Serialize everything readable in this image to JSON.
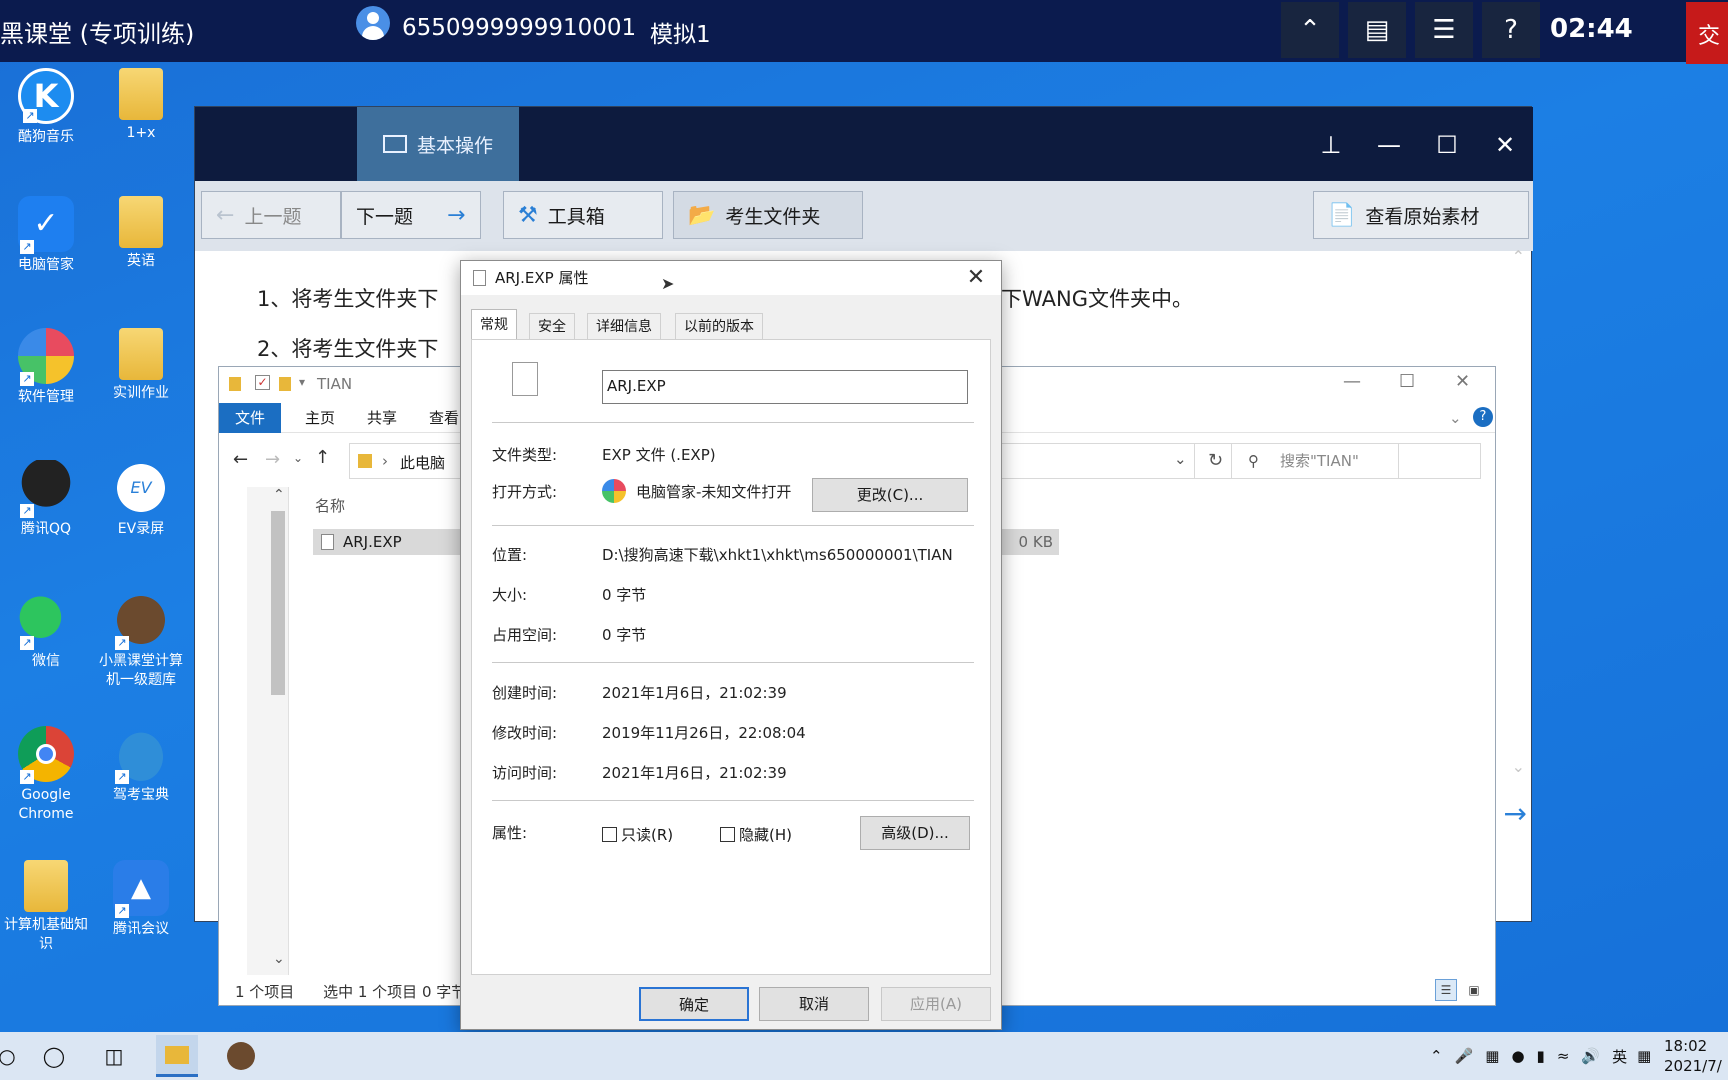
{
  "topbar": {
    "app_title": "黑课堂 (专项训练)",
    "exam_id": "6550999999910001",
    "mode": "模拟1",
    "timer": "02:44",
    "end_label": "交"
  },
  "desktop_icons": [
    {
      "label": "酷狗音乐"
    },
    {
      "label": "1+x"
    },
    {
      "label": "电脑管家"
    },
    {
      "label": "英语"
    },
    {
      "label": "软件管理"
    },
    {
      "label": "实训作业"
    },
    {
      "label": "腾讯QQ"
    },
    {
      "label": "EV录屏"
    },
    {
      "label": "微信"
    },
    {
      "label": "小黑课堂计算机一级题库"
    },
    {
      "label": "Google Chrome"
    },
    {
      "label": "驾考宝典"
    },
    {
      "label": "计算机基础知识"
    },
    {
      "label": "腾讯会议"
    }
  ],
  "main_window": {
    "tab_label": "基本操作",
    "prev_label": "上一题",
    "next_label": "下一题",
    "toolbox_label": "工具箱",
    "folder_label": "考生文件夹",
    "material_label": "查看原始素材",
    "q1_start": "1、将考生文件夹下",
    "q1_end": "下WANG文件夹中。",
    "q2_start": "2、将考生文件夹下"
  },
  "explorer": {
    "title": "TIAN",
    "tabs": [
      "文件",
      "主页",
      "共享",
      "查看"
    ],
    "breadcrumb": "此电脑",
    "search_placeholder": "搜索\"TIAN\"",
    "col_name": "名称",
    "file_name": "ARJ.EXP",
    "file_size": "0 KB",
    "status_items": "1 个项目",
    "status_selected": "选中 1 个项目  0 字节"
  },
  "properties": {
    "title": "ARJ.EXP 属性",
    "tabs": [
      "常规",
      "安全",
      "详细信息",
      "以前的版本"
    ],
    "filename": "ARJ.EXP",
    "type_label": "文件类型:",
    "type_value": "EXP 文件 (.EXP)",
    "openwith_label": "打开方式:",
    "openwith_value": "电脑管家-未知文件打开",
    "change_button": "更改(C)...",
    "location_label": "位置:",
    "location_value": "D:\\搜狗高速下载\\xhkt1\\xhkt\\ms650000001\\TIAN",
    "size_label": "大小:",
    "size_value": "0 字节",
    "disk_label": "占用空间:",
    "disk_value": "0 字节",
    "created_label": "创建时间:",
    "created_value": "2021年1月6日，21:02:39",
    "modified_label": "修改时间:",
    "modified_value": "2019年11月26日，22:08:04",
    "accessed_label": "访问时间:",
    "accessed_value": "2021年1月6日，21:02:39",
    "attr_label": "属性:",
    "readonly_label": "只读(R)",
    "hidden_label": "隐藏(H)",
    "advanced_button": "高级(D)...",
    "ok_button": "确定",
    "cancel_button": "取消",
    "apply_button": "应用(A)"
  },
  "taskbar": {
    "ime": "英",
    "time": "18:02",
    "date": "2021/7/"
  }
}
